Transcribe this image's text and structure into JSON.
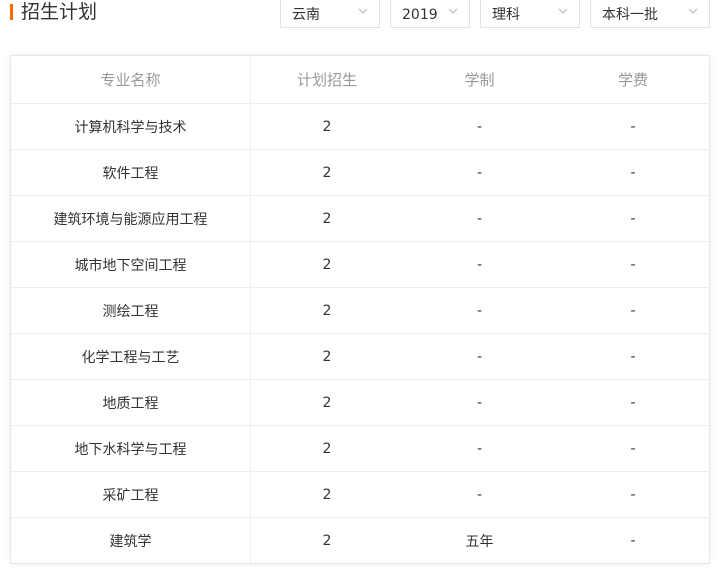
{
  "section": {
    "title": "招生计划"
  },
  "filters": [
    {
      "name": "province-select",
      "value": "云南"
    },
    {
      "name": "year-select",
      "value": "2019"
    },
    {
      "name": "subject-select",
      "value": "理科"
    },
    {
      "name": "batch-select",
      "value": "本科一批"
    }
  ],
  "table": {
    "columns": [
      "专业名称",
      "计划招生",
      "学制",
      "学费"
    ],
    "rows": [
      [
        "计算机科学与技术",
        "2",
        "-",
        "-"
      ],
      [
        "软件工程",
        "2",
        "-",
        "-"
      ],
      [
        "建筑环境与能源应用工程",
        "2",
        "-",
        "-"
      ],
      [
        "城市地下空间工程",
        "2",
        "-",
        "-"
      ],
      [
        "测绘工程",
        "2",
        "-",
        "-"
      ],
      [
        "化学工程与工艺",
        "2",
        "-",
        "-"
      ],
      [
        "地质工程",
        "2",
        "-",
        "-"
      ],
      [
        "地下水科学与工程",
        "2",
        "-",
        "-"
      ],
      [
        "采矿工程",
        "2",
        "-",
        "-"
      ],
      [
        "建筑学",
        "2",
        "五年",
        "-"
      ]
    ]
  },
  "colors": {
    "accent": "#ff6a00",
    "header_text": "#999999",
    "border": "#ededed"
  },
  "icons": {
    "dropdown": "chevron-down-icon"
  }
}
